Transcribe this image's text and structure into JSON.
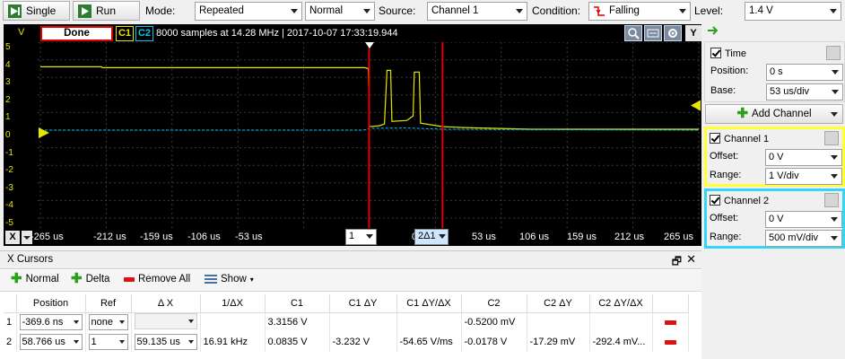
{
  "toolbar": {
    "single_label": "Single",
    "run_label": "Run",
    "mode_label": "Mode:",
    "mode_value": "Repeated",
    "normal_value": "Normal",
    "source_label": "Source:",
    "source_value": "Channel 1",
    "condition_label": "Condition:",
    "condition_value": "Falling",
    "level_label": "Level:",
    "level_value": "1.4 V"
  },
  "scope": {
    "status": "Done",
    "c1_tag": "C1",
    "c2_tag": "C2",
    "info": "8000 samples at 14.28 MHz | 2017-10-07 17:33:19.944",
    "v_label": "V",
    "y_label": "Y",
    "x_label": "X",
    "y_ticks": [
      "5",
      "4",
      "3",
      "2",
      "1",
      "0",
      "-1",
      "-2",
      "-3",
      "-4",
      "-5"
    ],
    "x_ticks": [
      "-265 us",
      "-212 us",
      "-159 us",
      "-106 us",
      "-53 us",
      "0",
      "53 us",
      "106 us",
      "159 us",
      "212 us",
      "265 us"
    ],
    "cursor1_label": "1",
    "cursor2_label": "2Δ1",
    "colors": {
      "channel1": "#e6e600",
      "channel2": "#00c8f0",
      "cursor": "#e00000"
    }
  },
  "chart_data": {
    "type": "line",
    "x_unit": "us",
    "y_unit": "V",
    "xlim": [
      -265,
      265
    ],
    "ylim": [
      -5.5,
      5
    ],
    "grid": true,
    "series": [
      {
        "name": "C1",
        "points": [
          [
            -265,
            3.6
          ],
          [
            -216,
            3.6
          ],
          [
            -215,
            3.55
          ],
          [
            -4,
            3.55
          ],
          [
            -1,
            3.5
          ],
          [
            0,
            0.2
          ],
          [
            8,
            0.25
          ],
          [
            12,
            0.35
          ],
          [
            14,
            3.4
          ],
          [
            17,
            3.4
          ],
          [
            18,
            0.5
          ],
          [
            30,
            0.55
          ],
          [
            35,
            0.8
          ],
          [
            36,
            3.3
          ],
          [
            40,
            3.3
          ],
          [
            41,
            0.4
          ],
          [
            59,
            0.2
          ],
          [
            75,
            0.15
          ],
          [
            130,
            0.05
          ],
          [
            265,
            0.05
          ]
        ]
      },
      {
        "name": "C2",
        "points": [
          [
            -265,
            0
          ],
          [
            -5,
            0
          ],
          [
            0,
            0.1
          ],
          [
            30,
            0.12
          ],
          [
            59,
            0.05
          ],
          [
            265,
            0
          ]
        ]
      }
    ],
    "cursors": [
      {
        "label": "1",
        "x": -0.37
      },
      {
        "label": "2",
        "x": 58.766
      }
    ],
    "trigger_x": 0,
    "trigger_level": 1.4
  },
  "right_panel": {
    "time_label": "Time",
    "position_label": "Position:",
    "position_value": "0 s",
    "base_label": "Base:",
    "base_value": "53 us/div",
    "add_channel_label": "Add Channel",
    "channel1": {
      "label": "Channel 1",
      "offset_label": "Offset:",
      "offset_value": "0 V",
      "range_label": "Range:",
      "range_value": "1 V/div"
    },
    "channel2": {
      "label": "Channel 2",
      "offset_label": "Offset:",
      "offset_value": "0 V",
      "range_label": "Range:",
      "range_value": "500 mV/div"
    }
  },
  "cursors_panel": {
    "title": "X Cursors",
    "normal_label": "Normal",
    "delta_label": "Delta",
    "remove_all_label": "Remove All",
    "show_label": "Show",
    "headers": [
      "",
      "Position",
      "Ref",
      "Δ X",
      "1/ΔX",
      "C1",
      "C1 ΔY",
      "C1 ΔY/ΔX",
      "C2",
      "C2 ΔY",
      "C2 ΔY/ΔX",
      ""
    ],
    "rows": [
      {
        "index": "1",
        "position": "-369.6 ns",
        "ref": "none",
        "dx": "",
        "inv_dx": "",
        "c1": "3.3156 V",
        "c1_dy": "",
        "c1_dydx": "",
        "c2": "-0.5200 mV",
        "c2_dy": "",
        "c2_dydx": ""
      },
      {
        "index": "2",
        "position": "58.766 us",
        "ref": "1",
        "dx": "59.135 us",
        "inv_dx": "16.91 kHz",
        "c1": "0.0835 V",
        "c1_dy": "-3.232 V",
        "c1_dydx": "-54.65 V/ms",
        "c2": "-0.0178 V",
        "c2_dy": "-17.29 mV",
        "c2_dydx": "-292.4 mV..."
      }
    ]
  }
}
